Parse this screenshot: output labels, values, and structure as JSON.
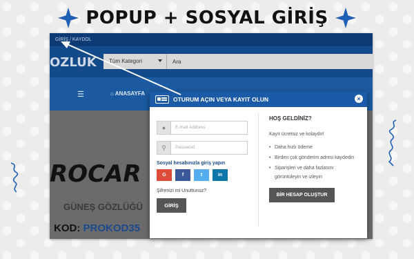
{
  "banner": {
    "title": "POPUP + SOSYAL GİRİŞ"
  },
  "site": {
    "topbar_link": "GİRİŞ / KAYDOL",
    "logo_fragment": "OZLUK",
    "category_select": "Tüm Kategori",
    "search_value": "Ara",
    "home_link": "ANASAYFA",
    "brand_fragment": "ROCAR",
    "brand_sub": "GÜNEŞ GÖZLÜĞÜ",
    "promo_label": "KOD:",
    "promo_code": "PROKOD35"
  },
  "modal": {
    "title": "OTURUM AÇIN VEYA KAYIT OLUN",
    "email_placeholder": "E-mail Address",
    "password_placeholder": "Password",
    "social_title": "Sosyal hesabınızla giriş yapın",
    "social_buttons": [
      {
        "label": "G",
        "color": "#dd4b39"
      },
      {
        "label": "f",
        "color": "#3b5998"
      },
      {
        "label": "t",
        "color": "#55acee"
      },
      {
        "label": "in",
        "color": "#0e76a8"
      }
    ],
    "forgot": "Şifrenizi mi Unuttunuz?",
    "login_button": "GİRİŞ",
    "welcome": "HOŞ GELDİNİZ?",
    "subline": "Kayıt ücretsiz ve kolaydır!",
    "benefits": [
      "Daha hızlı ödeme",
      "Birden çok gönderim adresi kaydedin",
      "Siparişleri ve daha fazlasını görüntüleyin ve izleyin"
    ],
    "signup_button": "BİR HESAP OLUŞTUR"
  },
  "colors": {
    "brand_blue": "#1a5aa6",
    "dark_blue": "#0b3a74",
    "accent_star": "#1e5fb5"
  }
}
